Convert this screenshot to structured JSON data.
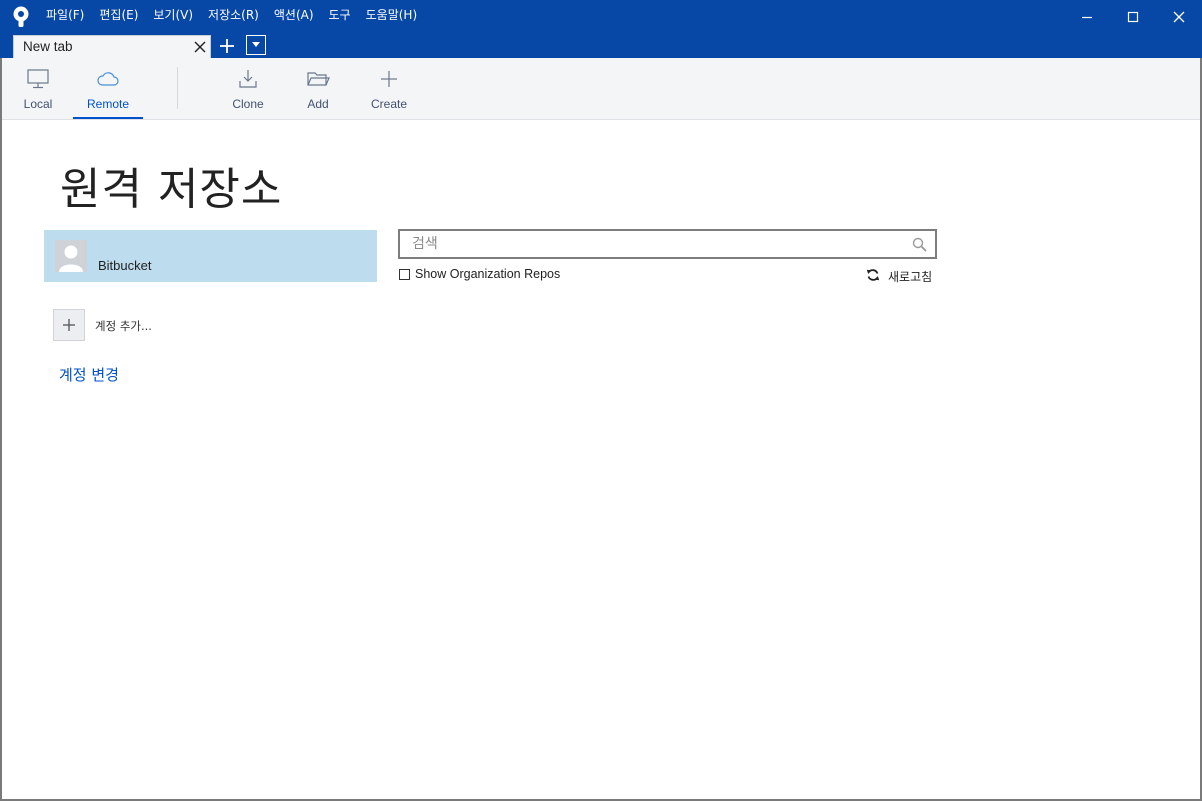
{
  "menu": {
    "items": [
      {
        "label": "파일(F)"
      },
      {
        "label": "편집(E)"
      },
      {
        "label": "보기(V)"
      },
      {
        "label": "저장소(R)"
      },
      {
        "label": "액션(A)"
      },
      {
        "label": "도구"
      },
      {
        "label": "도움말(H)"
      }
    ]
  },
  "tabs": {
    "active_label": "New tab"
  },
  "toolbar": {
    "local_label": "Local",
    "remote_label": "Remote",
    "clone_label": "Clone",
    "add_label": "Add",
    "create_label": "Create",
    "active": "Remote"
  },
  "main": {
    "title": "원격 저장소",
    "accounts": [
      {
        "name": "Bitbucket",
        "selected": true
      }
    ],
    "add_account_label": "계정 추가...",
    "change_account_label": "계정 변경",
    "search": {
      "placeholder": "검색",
      "value": ""
    },
    "show_org_repos_label": "Show Organization Repos",
    "show_org_repos_checked": false,
    "refresh_label": "새로고침"
  },
  "colors": {
    "titlebar": "#0747a6",
    "accent": "#0052cc",
    "selected_account_bg": "#bddcee",
    "toolbar_bg": "#f4f5f7"
  }
}
